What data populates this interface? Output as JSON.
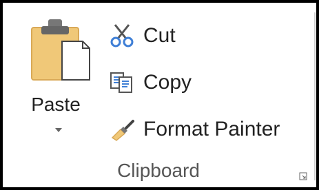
{
  "clipboard_group": {
    "paste": {
      "label": "Paste",
      "icon": "paste-icon"
    },
    "commands": [
      {
        "label": "Cut",
        "icon": "scissors-icon"
      },
      {
        "label": "Copy",
        "icon": "copy-icon"
      },
      {
        "label": "Format Painter",
        "icon": "paintbrush-icon"
      }
    ],
    "group_label": "Clipboard",
    "launcher_icon": "dialog-launcher-icon"
  },
  "colors": {
    "clipboard_tan": "#f0c878",
    "icon_blue": "#3f7fd6",
    "text": "#222222",
    "group_text": "#555555"
  }
}
